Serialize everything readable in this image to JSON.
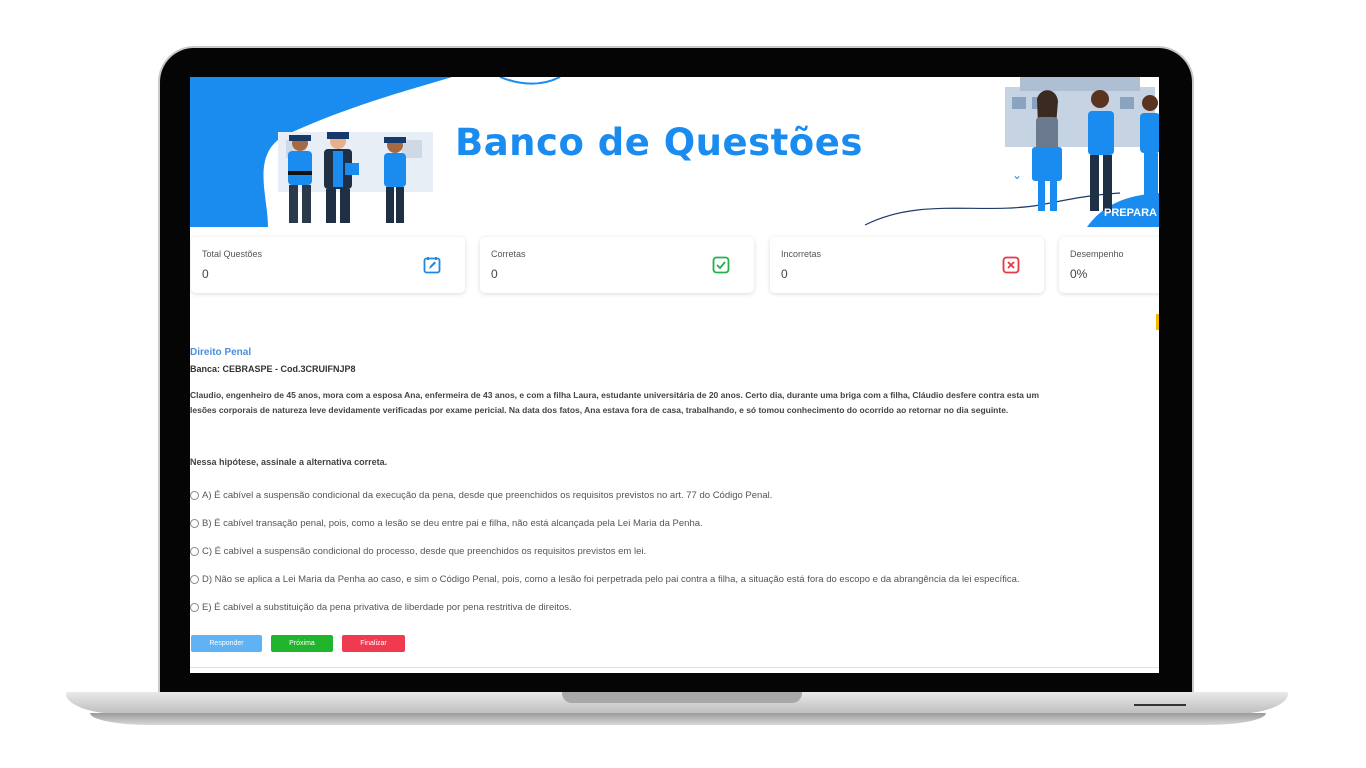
{
  "banner": {
    "title": "Banco de Questões",
    "tag": "PREPARA"
  },
  "stats": [
    {
      "label": "Total Questões",
      "value": "0",
      "icon": "edit-square-icon",
      "color": "#1e88e5"
    },
    {
      "label": "Corretas",
      "value": "0",
      "icon": "check-square-icon",
      "color": "#22b14c"
    },
    {
      "label": "Incorretas",
      "value": "0",
      "icon": "x-square-icon",
      "color": "#e53946"
    },
    {
      "label": "Desempenho",
      "value": "0%"
    }
  ],
  "question": {
    "subject": "Direito Penal",
    "banca": "Banca: CEBRASPE - Cod.3CRUIFNJP8",
    "stem_line1": "Claudio, engenheiro de 45 anos, mora com a esposa Ana, enfermeira de 43 anos, e com a filha Laura, estudante universitária de 20 anos. Certo dia, durante uma briga com a filha, Cláudio desfere contra esta um",
    "stem_line2": "lesões corporais de natureza leve devidamente verificadas por exame pericial. Na data dos fatos, Ana estava fora de casa, trabalhando, e só tomou conhecimento do ocorrido ao retornar no dia seguinte.",
    "prompt": "Nessa hipótese, assinale a alternativa correta.",
    "options": [
      "A) É cabível a suspensão condicional da execução da pena, desde que preenchidos os requisitos previstos no art. 77 do Código Penal.",
      "B) É cabível transação penal, pois, como a lesão se deu entre pai e filha, não está alcançada pela Lei Maria da Penha.",
      "C) É cabível a suspensão condicional do processo, desde que preenchidos os requisitos previstos em lei.",
      "D) Não se aplica a Lei Maria da Penha ao caso, e sim o Código Penal, pois, como a lesão foi perpetrada pelo pai contra a filha, a situação está fora do escopo e da abrangência da lei específica.",
      "E) É cabível a substituição da pena privativa de liberdade por pena restritiva de direitos."
    ]
  },
  "buttons": {
    "responder": "Responder",
    "proxima": "Próxima",
    "finalizar": "Finalizar"
  },
  "colors": {
    "brand_blue": "#1a8cf0",
    "responder": "#5fb2f4",
    "proxima": "#20b52c",
    "finalizar": "#f03a4f"
  }
}
